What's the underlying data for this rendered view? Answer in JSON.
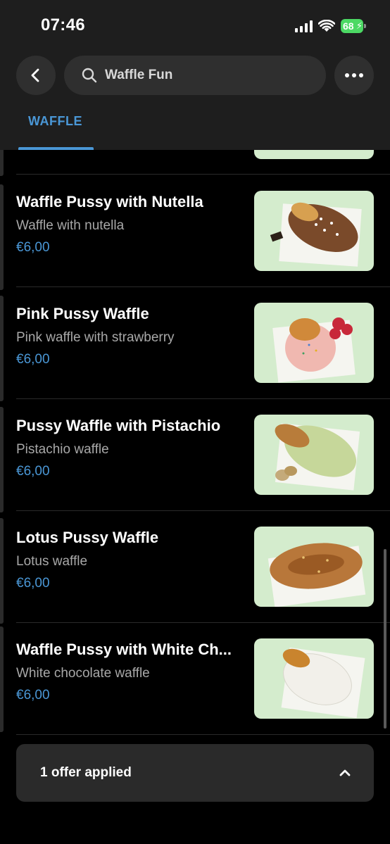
{
  "status": {
    "time": "07:46",
    "battery": "68"
  },
  "search": {
    "text": "Waffle Fun"
  },
  "tabs": [
    {
      "label": "WAFFLE",
      "active": true
    }
  ],
  "items": [
    {
      "name": "Waffle Pussy with Nutella",
      "desc": "Waffle with nutella",
      "price": "€6,00"
    },
    {
      "name": "Pink Pussy Waffle",
      "desc": "Pink waffle with strawberry",
      "price": "€6,00"
    },
    {
      "name": "Pussy Waffle with Pistachio",
      "desc": "Pistachio waffle",
      "price": "€6,00"
    },
    {
      "name": "Lotus Pussy Waffle",
      "desc": "Lotus waffle",
      "price": "€6,00"
    },
    {
      "name": "Waffle Pussy with White Ch...",
      "desc": "White chocolate waffle",
      "price": "€6,00"
    }
  ],
  "offer": {
    "text": "1 offer applied"
  },
  "colors": {
    "accent": "#4a97d6",
    "header_bg": "#1e1e1e",
    "thumb_bg": "#d4eccd",
    "battery": "#4cd964"
  },
  "icons": [
    "back-arrow-icon",
    "search-icon",
    "more-icon",
    "chevron-up-icon",
    "signal-icon",
    "wifi-icon",
    "battery-icon"
  ]
}
